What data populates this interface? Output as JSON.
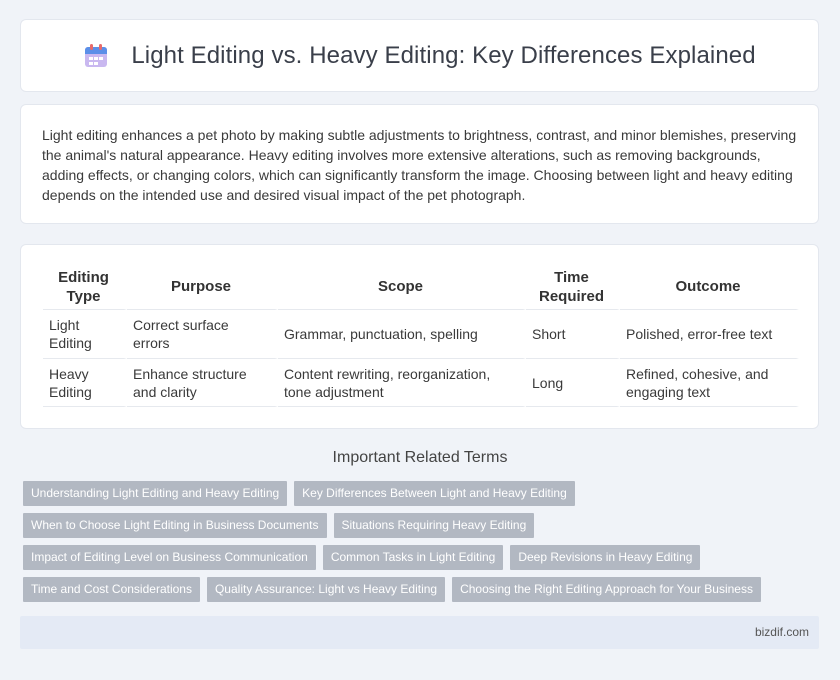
{
  "header": {
    "title": "Light Editing vs. Heavy Editing: Key Differences Explained",
    "icon": "calendar-icon"
  },
  "intro": {
    "text": "Light editing enhances a pet photo by making subtle adjustments to brightness, contrast, and minor blemishes, preserving the animal's natural appearance. Heavy editing involves more extensive alterations, such as removing backgrounds, adding effects, or changing colors, which can significantly transform the image. Choosing between light and heavy editing depends on the intended use and desired visual impact of the pet photograph."
  },
  "table": {
    "headers": [
      "Editing Type",
      "Purpose",
      "Scope",
      "Time Required",
      "Outcome"
    ],
    "rows": [
      [
        "Light Editing",
        "Correct surface errors",
        "Grammar, punctuation, spelling",
        "Short",
        "Polished, error-free text"
      ],
      [
        "Heavy Editing",
        "Enhance structure and clarity",
        "Content rewriting, reorganization, tone adjustment",
        "Long",
        "Refined, cohesive, and engaging text"
      ]
    ]
  },
  "related": {
    "title": "Important Related Terms",
    "tags": [
      "Understanding Light Editing and Heavy Editing",
      "Key Differences Between Light and Heavy Editing",
      "When to Choose Light Editing in Business Documents",
      "Situations Requiring Heavy Editing",
      "Impact of Editing Level on Business Communication",
      "Common Tasks in Light Editing",
      "Deep Revisions in Heavy Editing",
      "Time and Cost Considerations",
      "Quality Assurance: Light vs Heavy Editing",
      "Choosing the Right Editing Approach for Your Business"
    ]
  },
  "footer": {
    "site": "bizdif.com"
  },
  "colors": {
    "tag_bg": "#b2b8c2",
    "footer_bg": "#e4eaf5",
    "page_bg": "#f0f3f8"
  }
}
